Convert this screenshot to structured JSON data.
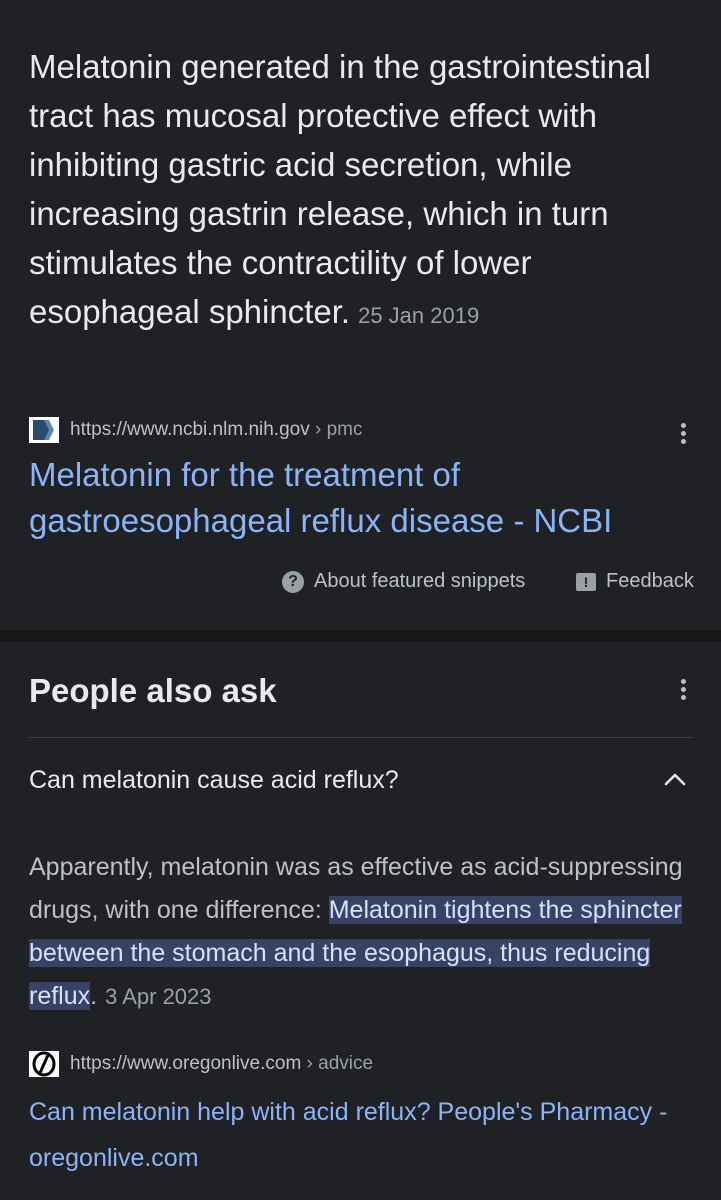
{
  "featured_snippet": {
    "text": "Melatonin generated in the gastrointestinal tract has mucosal protective effect with inhibiting gastric acid secretion, while increasing gastrin release, which in turn stimulates the contractility of lower esophageal sphincter.",
    "date": "25 Jan 2019",
    "source_url": "https://www.ncbi.nlm.nih.gov",
    "source_crumb": " › pmc",
    "title": "Melatonin for the treatment of gastroesophageal reflux disease - NCBI",
    "about_label": "About featured snippets",
    "feedback_label": "Feedback"
  },
  "people_also_ask": {
    "heading": "People also ask",
    "question": "Can melatonin cause acid reflux?",
    "answer_plain": "Apparently, melatonin was as effective as acid-suppressing drugs, with one difference: ",
    "answer_highlight": "Melatonin tightens the sphincter between the stomach and the esophagus, thus reducing reflux",
    "answer_end": ".",
    "date": "3 Apr 2023",
    "source_url": "https://www.oregonlive.com",
    "source_crumb": " › advice",
    "title": "Can melatonin help with acid reflux? People's Pharmacy - oregonlive.com"
  },
  "colors": {
    "background": "#202124",
    "link": "#8ab4f8",
    "highlight": "#394266"
  },
  "icons": [
    "ncbi-favicon",
    "more-vert-icon",
    "help-circle-icon",
    "feedback-icon",
    "chevron-up-icon",
    "oregonlive-favicon"
  ]
}
